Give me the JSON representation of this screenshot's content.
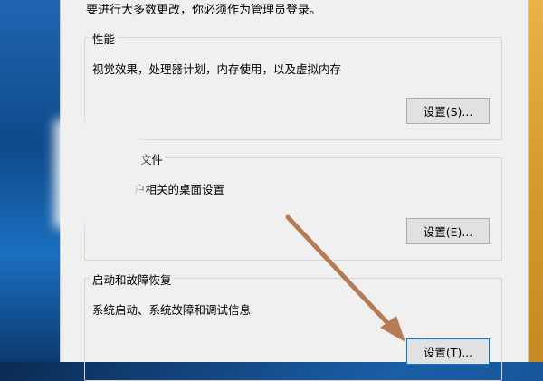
{
  "dialog": {
    "intro_text": "要进行大多数更改，你必须作为管理员登录。"
  },
  "performance": {
    "label": "性能",
    "description": "视觉效果，处理器计划，内存使用，以及虚拟内存",
    "button_label": "设置(S)..."
  },
  "user_profiles": {
    "label": "文件",
    "description": "户相关的桌面设置",
    "button_label": "设置(E)..."
  },
  "startup_recovery": {
    "label": "启动和故障恢复",
    "description": "系统启动、系统故障和调试信息",
    "button_label": "设置(T)..."
  },
  "annotation": {
    "arrow_color": "#b57b55"
  }
}
